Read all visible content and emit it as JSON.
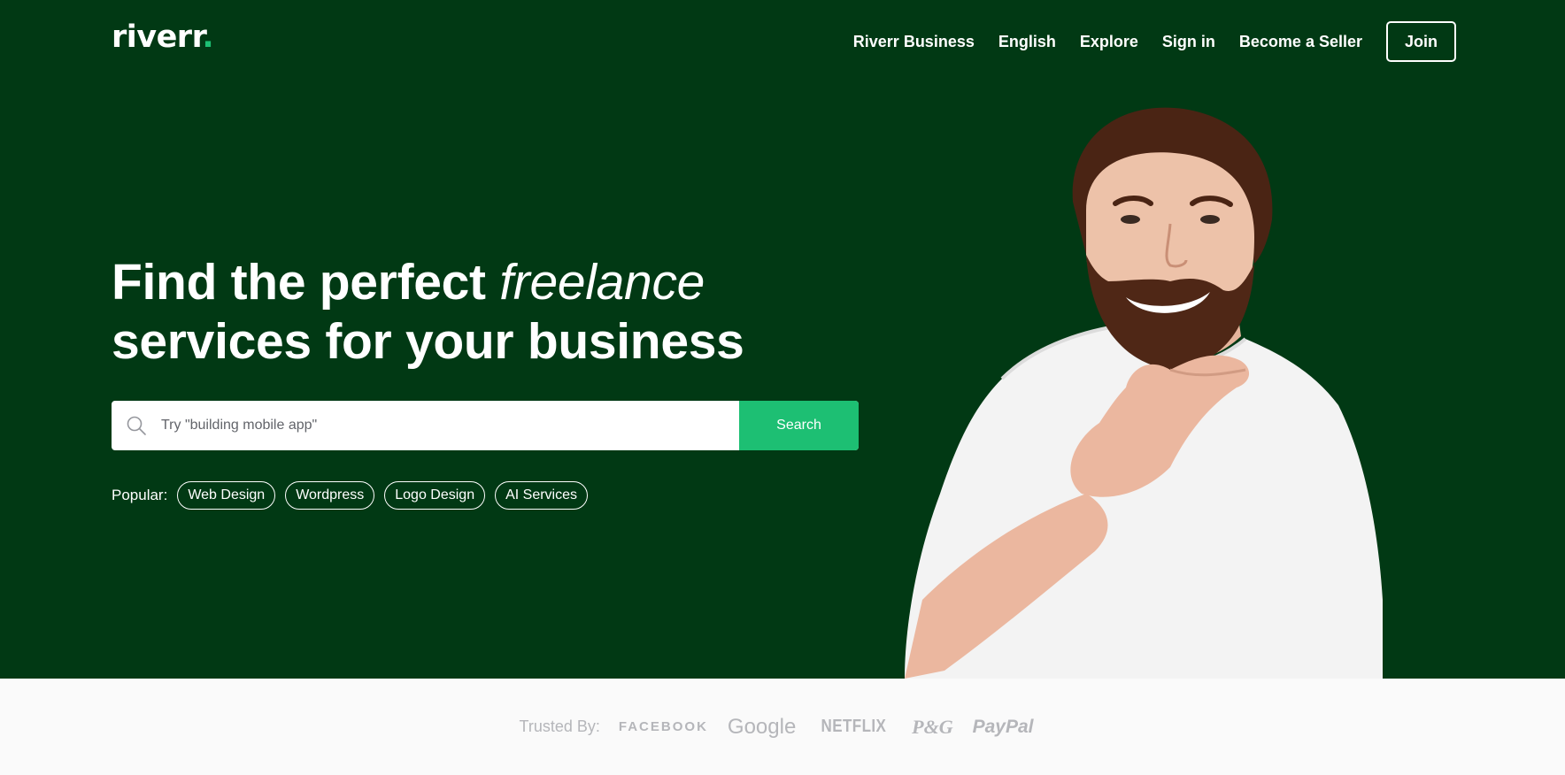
{
  "header": {
    "logo_text": "riverr",
    "logo_dot": ".",
    "nav": [
      "Riverr Business",
      "English",
      "Explore",
      "Sign in",
      "Become a Seller"
    ],
    "join_label": "Join"
  },
  "hero": {
    "headline_part1": "Find the perfect ",
    "headline_italic": "freelance",
    "headline_line2": "services for your business",
    "search": {
      "placeholder": "Try \"building mobile app\"",
      "value": "",
      "button_label": "Search"
    },
    "popular_label": "Popular:",
    "popular_tags": [
      "Web Design",
      "Wordpress",
      "Logo Design",
      "AI Services"
    ]
  },
  "trusted": {
    "label": "Trusted By:",
    "brands": [
      "FACEBOOK",
      "Google",
      "NETFLIX",
      "P&G",
      "PayPal"
    ]
  },
  "colors": {
    "hero_bg": "#013914",
    "accent": "#1dbf73",
    "trusted_bg": "#fafafa",
    "trusted_text": "#b5b6ba"
  },
  "icons": {
    "search": "search-icon"
  }
}
